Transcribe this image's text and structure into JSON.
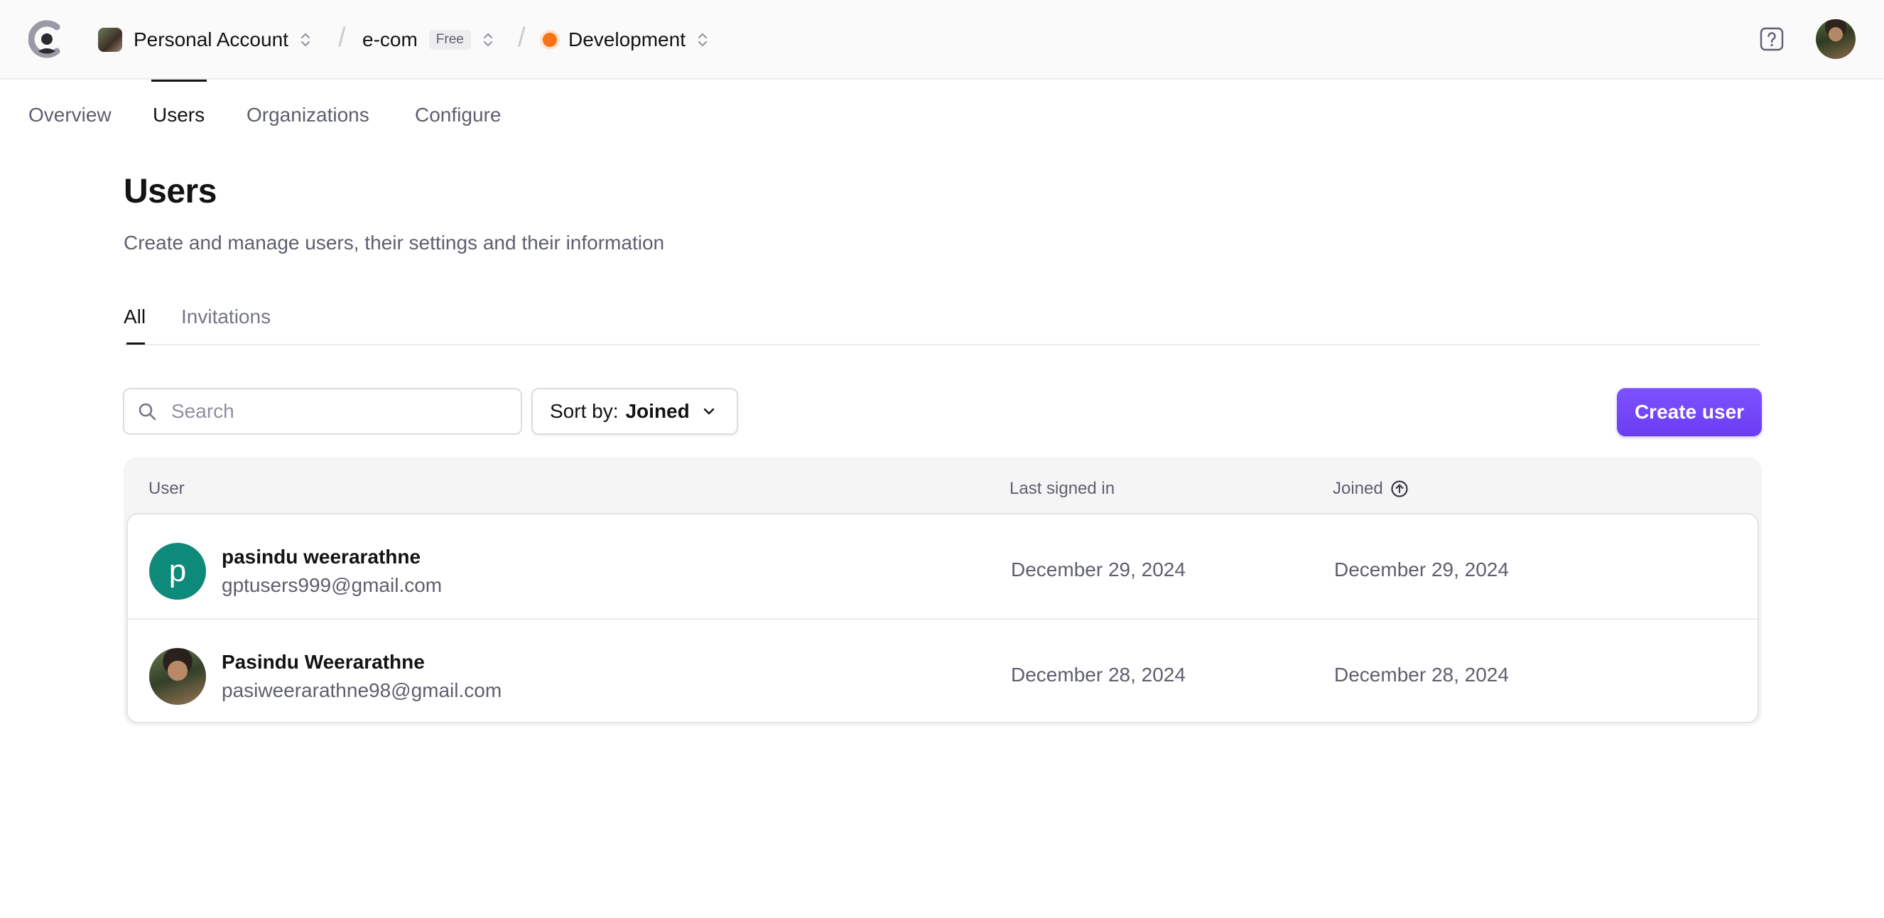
{
  "topbar": {
    "account_label": "Personal Account",
    "app_label": "e-com",
    "plan_badge": "Free",
    "env_label": "Development",
    "env_color": "#f97316"
  },
  "nav": {
    "tabs": [
      {
        "label": "Overview"
      },
      {
        "label": "Users"
      },
      {
        "label": "Organizations"
      },
      {
        "label": "Configure"
      }
    ],
    "active": "Users"
  },
  "page": {
    "title": "Users",
    "description": "Create and manage users, their settings and their information"
  },
  "sub_tabs": {
    "items": [
      {
        "label": "All"
      },
      {
        "label": "Invitations"
      }
    ],
    "active": "All"
  },
  "search": {
    "placeholder": "Search",
    "value": ""
  },
  "sort": {
    "prefix": "Sort by:",
    "value": "Joined"
  },
  "actions": {
    "create_user": "Create user"
  },
  "accent_color": "#6c47ff",
  "table": {
    "columns": [
      "User",
      "Last signed in",
      "Joined"
    ],
    "sort_indicator_icon": "arrow-up-circle-icon",
    "rows": [
      {
        "avatar_letter": "p",
        "avatar_color": "#0e8a7a",
        "name": "pasindu weerarathne",
        "email": "gptusers999@gmail.com",
        "last_signed_in": "December 29, 2024",
        "joined": "December 29, 2024"
      },
      {
        "avatar_letter": "",
        "avatar_type": "photo",
        "name": "Pasindu Weerarathne",
        "email": "pasiweerarathne98@gmail.com",
        "last_signed_in": "December 28, 2024",
        "joined": "December 28, 2024"
      }
    ]
  }
}
